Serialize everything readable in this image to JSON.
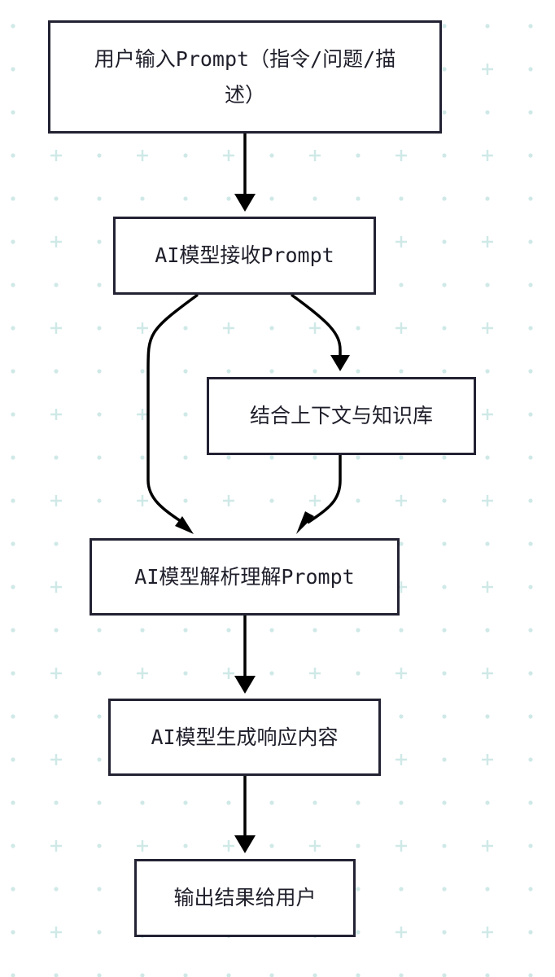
{
  "diagram": {
    "type": "flowchart",
    "nodes": [
      {
        "id": "input",
        "label": "用户输入Prompt（指令/问题/描述）"
      },
      {
        "id": "receive",
        "label": "AI模型接收Prompt"
      },
      {
        "id": "context",
        "label": "结合上下文与知识库"
      },
      {
        "id": "parse",
        "label": "AI模型解析理解Prompt"
      },
      {
        "id": "generate",
        "label": "AI模型生成响应内容"
      },
      {
        "id": "output",
        "label": "输出结果给用户"
      }
    ],
    "edges": [
      {
        "from": "input",
        "to": "receive"
      },
      {
        "from": "receive",
        "to": "parse"
      },
      {
        "from": "receive",
        "to": "context"
      },
      {
        "from": "context",
        "to": "parse"
      },
      {
        "from": "parse",
        "to": "generate"
      },
      {
        "from": "generate",
        "to": "output"
      }
    ]
  },
  "style": {
    "background": "#ffffff",
    "grid_mark_color": "#cfe9e7",
    "node_border_color": "#222233",
    "edge_color": "#000000",
    "text_color": "#1f1f2b"
  }
}
